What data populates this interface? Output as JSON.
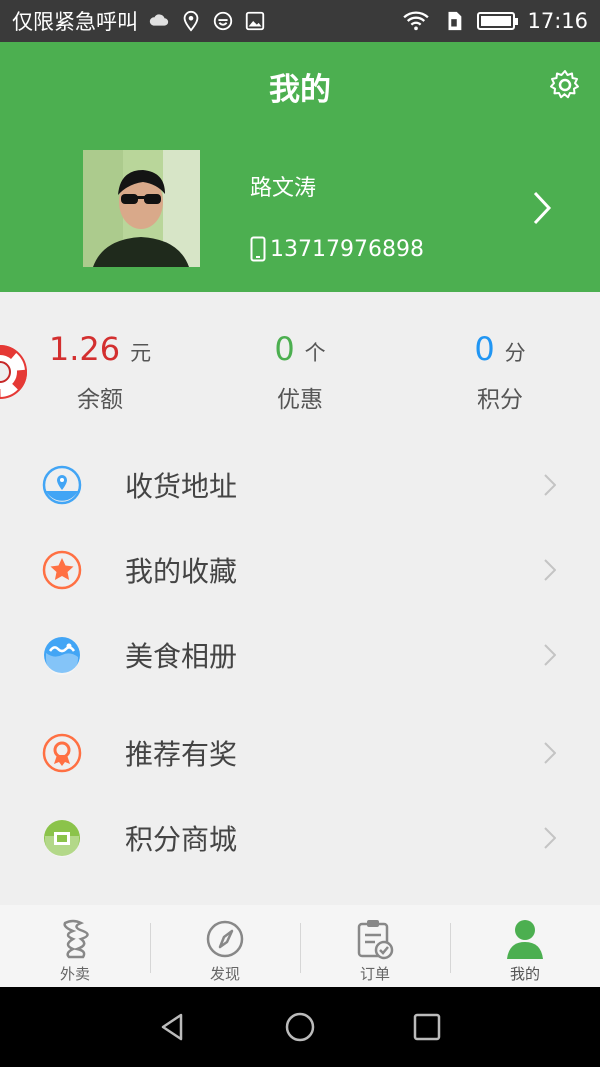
{
  "status_bar": {
    "carrier": "仅限紧急呼叫",
    "time": "17:16"
  },
  "header": {
    "title": "我的",
    "background_color": "#4caf50",
    "user_name": "路文涛",
    "phone": "13717976898"
  },
  "stats": [
    {
      "value": "1.26",
      "unit": "元",
      "label": "余额",
      "color": "#d32f2f"
    },
    {
      "value": "0",
      "unit": "个",
      "label": "优惠",
      "color": "#4caf50"
    },
    {
      "value": "0",
      "unit": "分",
      "label": "积分",
      "color": "#2196f3"
    }
  ],
  "menu": [
    {
      "label": "收货地址",
      "icon": "location-icon",
      "color": "#42a5f5"
    },
    {
      "label": "我的收藏",
      "icon": "star-icon",
      "color": "#ff7043"
    },
    {
      "label": "美食相册",
      "icon": "album-icon",
      "color": "#42a5f5"
    },
    {
      "label": "推荐有奖",
      "icon": "award-icon",
      "color": "#ff7043"
    },
    {
      "label": "积分商城",
      "icon": "shop-icon",
      "color": "#8bc34a"
    }
  ],
  "tabs": [
    {
      "label": "外卖",
      "icon": "takeout-icon"
    },
    {
      "label": "发现",
      "icon": "compass-icon"
    },
    {
      "label": "订单",
      "icon": "order-icon"
    },
    {
      "label": "我的",
      "icon": "person-icon",
      "active": true,
      "color": "#4caf50"
    }
  ]
}
